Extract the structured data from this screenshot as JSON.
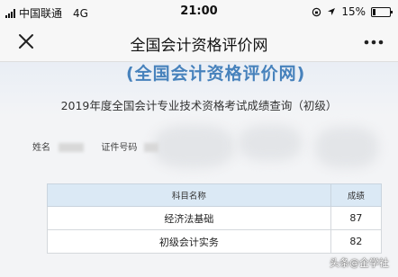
{
  "status_bar": {
    "carrier": "中国联通",
    "network": "4G",
    "time": "21:00",
    "battery_percent_text": "15%",
    "battery_level": 0.15
  },
  "nav": {
    "title": "全国会计资格评价网",
    "close_icon": "close-icon",
    "more_icon": "more-icon"
  },
  "page": {
    "banner": "(全国会计资格评价网)",
    "query_title": "2019年度全国会计专业技术资格考试成绩查询（初级）",
    "name_label": "姓名",
    "id_label": "证件号码"
  },
  "table": {
    "headers": [
      "科目名称",
      "成绩"
    ],
    "rows": [
      {
        "subject": "经济法基础",
        "score": "87"
      },
      {
        "subject": "初级会计实务",
        "score": "82"
      }
    ]
  },
  "watermark": "头条@企学社"
}
